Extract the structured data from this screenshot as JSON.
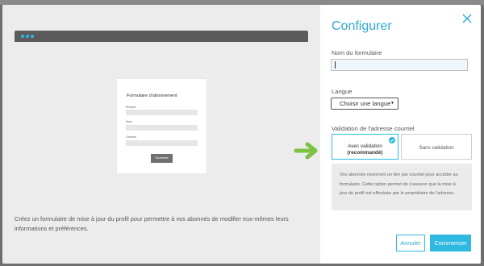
{
  "background_strip": {
    "text": ""
  },
  "preview": {
    "mock_form": {
      "title": "Formulaire d'abonnement",
      "fields": [
        {
          "label": "Prénom"
        },
        {
          "label": "Nom"
        },
        {
          "label": "Courriel"
        }
      ],
      "submit_label": "Soumettre"
    },
    "description": "Créez un formulaire de mise à jour du profil pour permettre à vos abonnés de modifier eux-mêmes leurs informations et préférences."
  },
  "panel": {
    "title": "Configurer",
    "form_name": {
      "label": "Nom du formulaire",
      "value": "",
      "placeholder": ""
    },
    "language": {
      "label": "Langue",
      "selected": "Choisir une langue"
    },
    "validation": {
      "label": "Validation de l'adresse courriel",
      "options": [
        {
          "line1": "Avec validation",
          "line2": "(recommandé)",
          "selected": true
        },
        {
          "line1": "Sans validation",
          "selected": false
        }
      ],
      "info": "Vos abonnés recevront un lien par courriel pour accéder au formulaire. Cette option permet de s'assurer que la mise à jour du profil est effectuée par le propriétaire de l'adresse."
    },
    "buttons": {
      "cancel": "Annuler",
      "start": "Commencer"
    }
  },
  "colors": {
    "accent": "#2fb8e0",
    "arrow": "#7cc242",
    "preview_bg": "#ececec",
    "backdrop": "#6e6e6e"
  },
  "icons": {
    "close": "close-icon",
    "check": "check-circle-icon",
    "caret": "caret-down-icon",
    "arrow": "arrow-right-icon"
  }
}
